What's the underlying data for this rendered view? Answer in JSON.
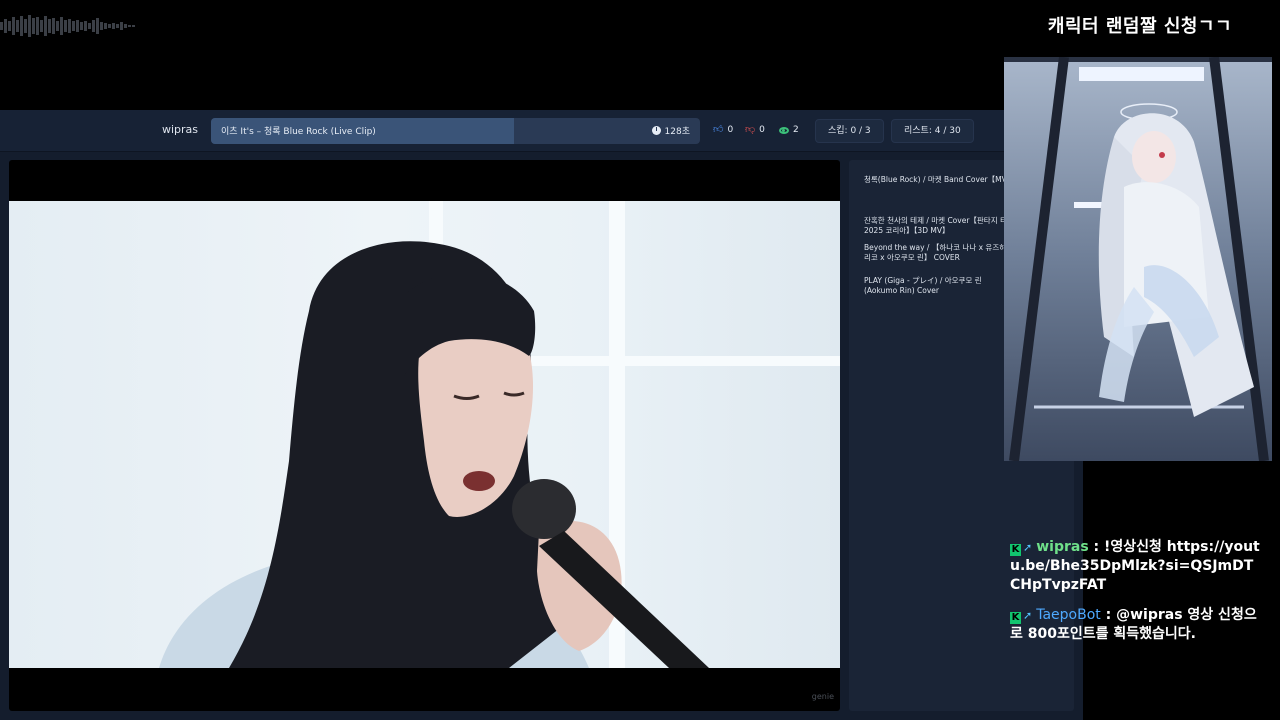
{
  "overlay": {
    "title": "캐릭터 랜덤짤 신청ㄱㄱ"
  },
  "topbar": {
    "username": "wipras",
    "now_playing": {
      "title": "이츠 It's – 청록 Blue Rock (Live Clip)",
      "time": "128초",
      "progress_fraction": 0.62
    },
    "stats": {
      "likes": "0",
      "dislikes": "0",
      "views": "2"
    },
    "skip": "스킵: 0 / 3",
    "list": "리스트: 4 / 30"
  },
  "video": {
    "watermark": "genie"
  },
  "playlist": {
    "items": [
      "청록(Blue Rock) / 마켓 Band Cover【MV】",
      "잔혹한 천사의 테제 / 마켓 Cover【판타지 티빌 2025 코리아】【3D MV】",
      "Beyond the way / 【하나코 나나 x 유즈하 리코 x 아오쿠모 린】 COVER",
      "PLAY (Giga - プレイ) / 아오쿠모 린 (Aokumo Rin) Cover"
    ]
  },
  "chat": {
    "messages": [
      {
        "nick": "wipras",
        "text": " : !영상신청 https://youtu.be/Bhe35DpMlzk?si=QSJmDTCHpTvpzFAT"
      },
      {
        "nick": "TaepoBot",
        "text": " : @wipras 영상 신청으로 800포인트를 획득했습니다."
      }
    ]
  },
  "colors": {
    "accent_like": "#4d8ff0",
    "accent_dislike": "#e05252",
    "accent_view": "#3cc07a",
    "chat_badge": "#11c56f"
  }
}
